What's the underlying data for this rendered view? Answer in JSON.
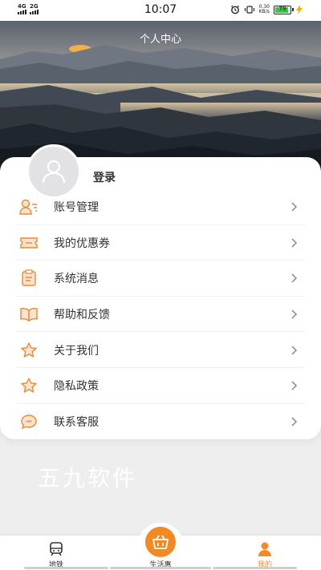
{
  "status_bar": {
    "net_left": "4G",
    "net_right": "2G",
    "time": "10:07",
    "speed_value": "0.30",
    "speed_unit": "KB/s",
    "battery": "79"
  },
  "header": {
    "title": "个人中心"
  },
  "profile": {
    "login_label": "登录"
  },
  "menu": [
    {
      "label": "账号管理",
      "icon": "account-icon"
    },
    {
      "label": "我的优惠券",
      "icon": "coupon-icon"
    },
    {
      "label": "系统消息",
      "icon": "message-icon"
    },
    {
      "label": "帮助和反馈",
      "icon": "book-icon"
    },
    {
      "label": "关于我们",
      "icon": "star-icon"
    },
    {
      "label": "隐私政策",
      "icon": "star-icon"
    },
    {
      "label": "联系客服",
      "icon": "chat-icon"
    }
  ],
  "watermark": "五九软件",
  "bottom_nav": {
    "items": [
      {
        "label": "地铁",
        "icon": "subway-icon"
      },
      {
        "label": "生活惠",
        "icon": "basket-icon"
      },
      {
        "label": "我的",
        "icon": "person-icon"
      }
    ],
    "active": "我的"
  },
  "colors": {
    "accent": "#f28a24",
    "text": "#333333",
    "background": "#eeeeef"
  }
}
